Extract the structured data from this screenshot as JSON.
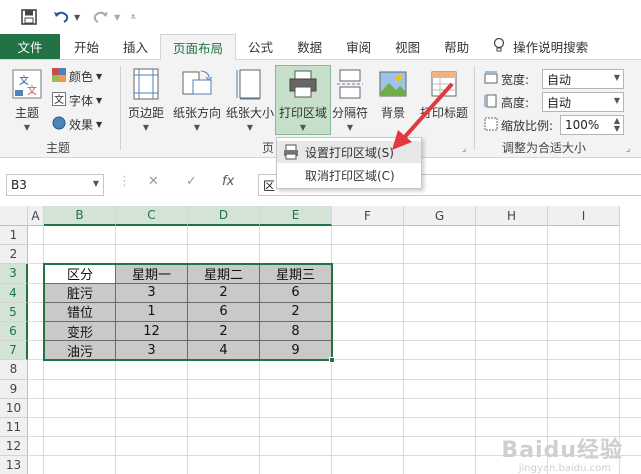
{
  "qat": {
    "save_icon": "save-icon",
    "undo_icon": "undo-icon",
    "redo_icon": "redo-icon",
    "customize_icon": "customize-qat-icon"
  },
  "tabs": {
    "file": "文件",
    "home": "开始",
    "insert": "插入",
    "page_layout": "页面布局",
    "formulas": "公式",
    "data": "数据",
    "review": "审阅",
    "view": "视图",
    "help": "帮助",
    "tell_me": "操作说明搜索"
  },
  "ribbon": {
    "themes": {
      "label": "主题",
      "group": "主题",
      "colors": "颜色",
      "fonts": "字体",
      "effects": "效果"
    },
    "page_setup": {
      "margins": "页边距",
      "orientation": "纸张方向",
      "size": "纸张大小",
      "print_area": "打印区域",
      "breaks": "分隔符",
      "background": "背景",
      "print_titles": "打印标题",
      "group": "页"
    },
    "scale": {
      "width_label": "宽度:",
      "width_value": "自动",
      "height_label": "高度:",
      "height_value": "自动",
      "scale_label": "缩放比例:",
      "scale_value": "100%",
      "group": "调整为合适大小"
    }
  },
  "dropdown": {
    "set_print_area": "设置打印区域(S)",
    "clear_print_area": "取消打印区域(C)"
  },
  "formula_bar": {
    "name_box": "B3",
    "cancel": "✕",
    "enter": "✓",
    "fx": "fx",
    "content": "区"
  },
  "grid": {
    "columns": [
      "A",
      "B",
      "C",
      "D",
      "E",
      "F",
      "G",
      "H",
      "I"
    ],
    "rows": [
      "1",
      "2",
      "3",
      "4",
      "5",
      "6",
      "7",
      "8",
      "9",
      "10",
      "11",
      "12",
      "13"
    ],
    "table_header": [
      "区分",
      "星期一",
      "星期二",
      "星期三"
    ],
    "table_rows": [
      [
        "脏污",
        "3",
        "2",
        "6"
      ],
      [
        "错位",
        "1",
        "6",
        "2"
      ],
      [
        "变形",
        "12",
        "2",
        "8"
      ],
      [
        "油污",
        "3",
        "4",
        "9"
      ]
    ]
  },
  "colors": {
    "accent": "#217346",
    "arrow": "#e0393e",
    "shade": "#c9c9c9"
  },
  "watermark": {
    "text": "Baidu经验",
    "sub": "jingyan.baidu.com"
  }
}
